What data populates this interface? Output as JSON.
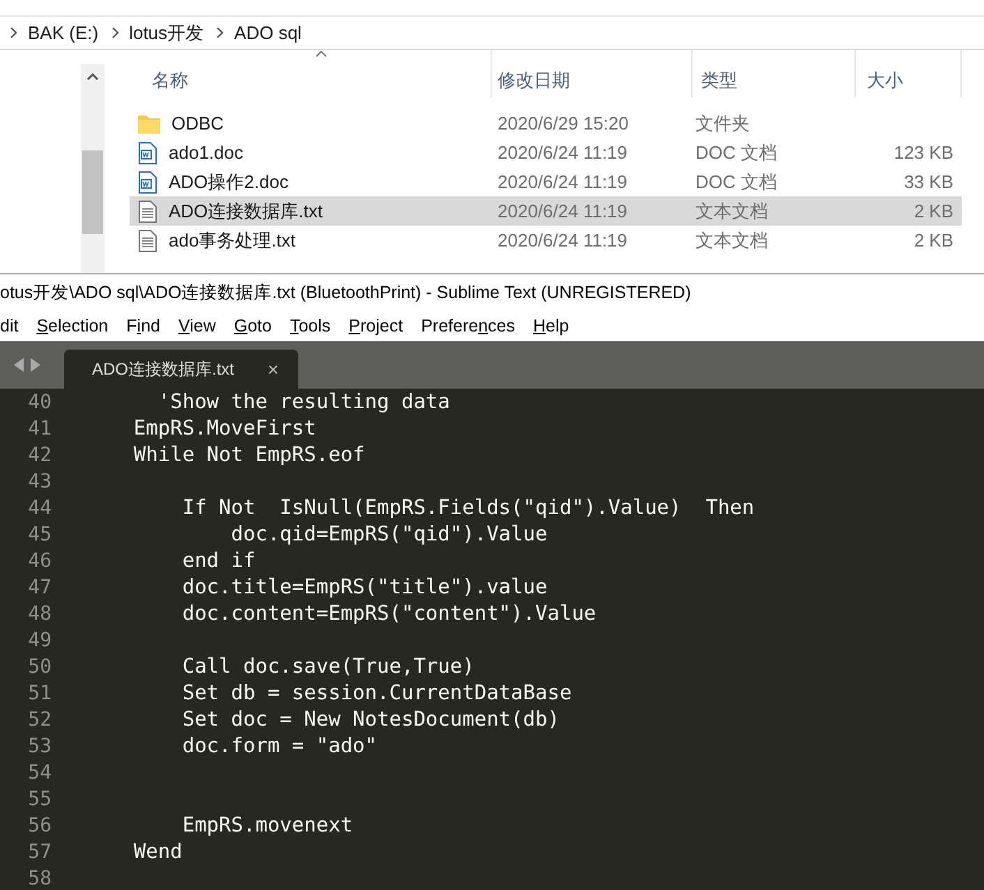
{
  "explorer": {
    "breadcrumb": [
      "BAK (E:)",
      "lotus开发",
      "ADO sql"
    ],
    "columns": [
      {
        "label": "名称",
        "sorted": true
      },
      {
        "label": "修改日期",
        "sorted": false
      },
      {
        "label": "类型",
        "sorted": false
      },
      {
        "label": "大小",
        "sorted": false
      }
    ],
    "files": [
      {
        "kind": "folder",
        "name": "ODBC",
        "date": "2020/6/29 15:20",
        "type": "文件夹",
        "selected": false
      },
      {
        "kind": "doc",
        "name": "ado1.doc",
        "date": "2020/6/24 11:19",
        "type": "DOC 文档",
        "size": "123 KB",
        "selected": false
      },
      {
        "kind": "doc",
        "name": "ADO操作2.doc",
        "date": "2020/6/24 11:19",
        "type": "DOC 文档",
        "size": "33 KB",
        "selected": false
      },
      {
        "kind": "txt",
        "name": "ADO连接数据库.txt",
        "date": "2020/6/24 11:19",
        "type": "文本文档",
        "size": "2 KB",
        "selected": true
      },
      {
        "kind": "txt",
        "name": "ado事务处理.txt",
        "date": "2020/6/24 11:19",
        "type": "文本文档",
        "size": "2 KB",
        "selected": false
      }
    ]
  },
  "editor": {
    "title": "otus开发\\ADO sql\\ADO连接数据库.txt (BluetoothPrint) - Sublime Text (UNREGISTERED)",
    "menu": [
      {
        "pre": "dit"
      },
      {
        "key": "S",
        "post": "election"
      },
      {
        "pre": "F",
        "key": "i",
        "post": "nd"
      },
      {
        "key": "V",
        "post": "iew"
      },
      {
        "key": "G",
        "post": "oto"
      },
      {
        "key": "T",
        "post": "ools"
      },
      {
        "key": "P",
        "post": "roject"
      },
      {
        "pre": "Prefere",
        "key": "n",
        "post": "ces"
      },
      {
        "key": "H",
        "post": "elp"
      }
    ],
    "tabs": [
      {
        "label": "ADO连接数据库.txt",
        "close": "×",
        "selected": true
      }
    ],
    "lines": [
      {
        "number": "40",
        "code": "      'Show the resulting data"
      },
      {
        "number": "41",
        "code": "    EmpRS.MoveFirst"
      },
      {
        "number": "42",
        "code": "    While Not EmpRS.eof"
      },
      {
        "number": "43"
      },
      {
        "number": "44",
        "code": "        If Not  IsNull(EmpRS.Fields(\"qid\").Value)  Then"
      },
      {
        "number": "45",
        "code": "            doc.qid=EmpRS(\"qid\").Value"
      },
      {
        "number": "46",
        "code": "        end if"
      },
      {
        "number": "47",
        "code": "        doc.title=EmpRS(\"title\").value"
      },
      {
        "number": "48",
        "code": "        doc.content=EmpRS(\"content\").Value"
      },
      {
        "number": "49"
      },
      {
        "number": "50",
        "code": "        Call doc.save(True,True)"
      },
      {
        "number": "51",
        "code": "        Set db = session.CurrentDataBase"
      },
      {
        "number": "52",
        "code": "        Set doc = New NotesDocument(db)"
      },
      {
        "number": "53",
        "code": "        doc.form = \"ado\""
      },
      {
        "number": "54"
      },
      {
        "number": "55"
      },
      {
        "number": "56",
        "code": "        EmpRS.movenext"
      },
      {
        "number": "57",
        "code": "    Wend"
      },
      {
        "number": "58"
      }
    ]
  }
}
